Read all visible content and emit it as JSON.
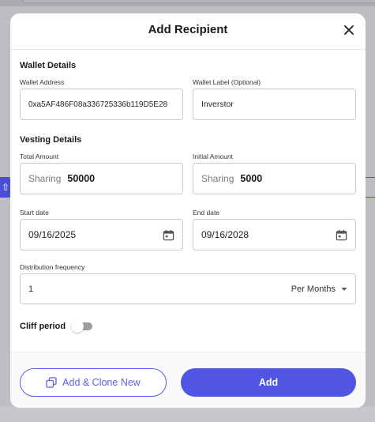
{
  "modal": {
    "title": "Add Recipient"
  },
  "wallet": {
    "section_title": "Wallet Details",
    "address_label": "Wallet Address",
    "address_value": "0xa5AF486F08a336725336b119D5E28",
    "label_label": "Wallet Label (Optional)",
    "label_value": "Inverstor"
  },
  "vesting": {
    "section_title": "Vesting Details",
    "total_label": "Total Amount",
    "total_prefix": "Sharing",
    "total_value": "50000",
    "initial_label": "Initial Amount",
    "initial_prefix": "Sharing",
    "initial_value": "5000",
    "start_label": "Start date",
    "start_value": "09/16/2025",
    "end_label": "End date",
    "end_value": "09/16/2028",
    "frequency_label": "Distribution frequency",
    "frequency_value": "1",
    "frequency_unit": "Per Months"
  },
  "cliff": {
    "label": "Cliff period",
    "enabled": false
  },
  "footer": {
    "clone_label": "Add & Clone New",
    "add_label": "Add"
  },
  "colors": {
    "accent": "#5055e3",
    "overlay": "#bdbdc2"
  },
  "icons": {
    "close": "close-icon",
    "calendar": "calendar-icon",
    "dropdown": "chevron-down-icon",
    "clone": "copy-icon",
    "side_tab": "arrow-up-icon"
  }
}
